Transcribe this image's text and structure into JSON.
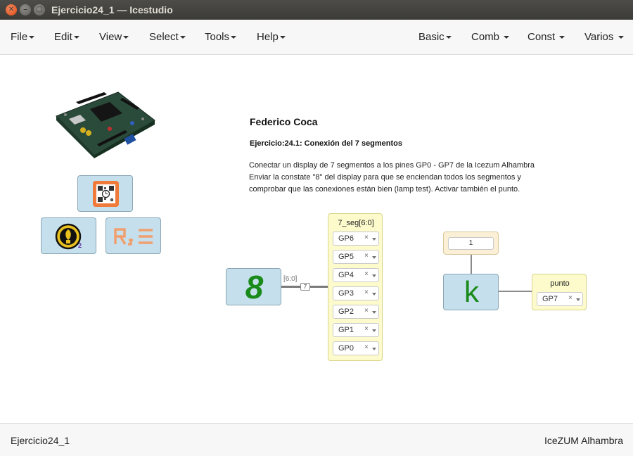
{
  "window": {
    "title": "Ejercicio24_1 — Icestudio"
  },
  "menu_left": [
    "File",
    "Edit",
    "View",
    "Select",
    "Tools",
    "Help"
  ],
  "menu_right": [
    "Basic",
    "Comb",
    "Const",
    "Varios"
  ],
  "info": {
    "author": "Federico Coca",
    "exercise_prefix": "Ejercicio:24.1",
    "exercise_title": ": Conexión del 7 segmentos",
    "desc_line1": "Conectar un display de 7 segmentos a los pines GP0 - GP7 de la Icezum Alhambra",
    "desc_line2": "Enviar la constate \"8\" del display para que se enciendan todos los segmentos y",
    "desc_line3": "comprobar que las conexiones están bien (lamp test). Activar también el punto."
  },
  "display_block": {
    "glyph": "8"
  },
  "bus": {
    "label": "[6:0]",
    "width": "7"
  },
  "output_block": {
    "title": "7_seg[6:0]",
    "pins": [
      "GP6",
      "GP5",
      "GP4",
      "GP3",
      "GP2",
      "GP1",
      "GP0"
    ],
    "clear_glyph": "×"
  },
  "constant_block": {
    "value": "1",
    "glyph": "k"
  },
  "punto_block": {
    "title": "punto",
    "pin": "GP7",
    "clear_glyph": "×"
  },
  "icons": {
    "qr_badge_index": "2"
  },
  "status": {
    "left": "Ejercicio24_1",
    "right": "IceZUM Alhambra"
  },
  "colors": {
    "block_blue": "#c5e0ec",
    "block_yellow": "#fdfbcc",
    "glyph_green": "#1a8a1a",
    "accent_orange": "#f07a3a"
  }
}
